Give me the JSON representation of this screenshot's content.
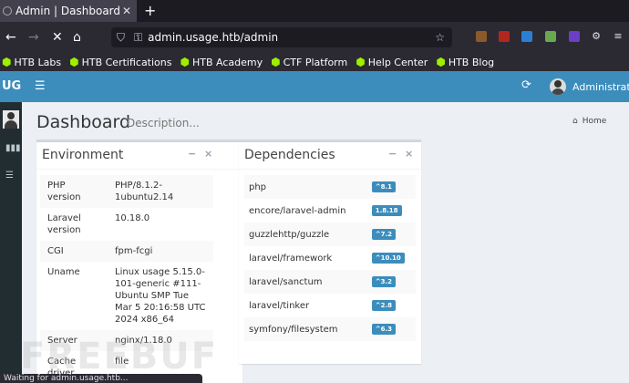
{
  "browser": {
    "tab_title": "Admin | Dashboard",
    "new_tab": "+",
    "url": "admin.usage.htb/admin",
    "bookmarks": [
      "HTB Labs",
      "HTB Certifications",
      "HTB Academy",
      "CTF Platform",
      "Help Center",
      "HTB Blog"
    ],
    "status_text": "Waiting for admin.usage.htb..."
  },
  "header": {
    "logo": "UG",
    "user_name": "Administrator",
    "brand_color": "#3c8dbc"
  },
  "page": {
    "title": "Dashboard",
    "description": "Description...",
    "breadcrumb": "Home"
  },
  "environment": {
    "title": "Environment",
    "rows": [
      {
        "key": "PHP version",
        "value": "PHP/8.1.2-1ubuntu2.14"
      },
      {
        "key": "Laravel version",
        "value": "10.18.0"
      },
      {
        "key": "CGI",
        "value": "fpm-fcgi"
      },
      {
        "key": "Uname",
        "value": "Linux usage 5.15.0-101-generic #111-Ubuntu SMP Tue Mar 5 20:16:58 UTC 2024 x86_64"
      },
      {
        "key": "Server",
        "value": "nginx/1.18.0"
      },
      {
        "key": "Cache driver",
        "value": "file"
      }
    ]
  },
  "dependencies": {
    "title": "Dependencies",
    "rows": [
      {
        "name": "php",
        "version": "^8.1"
      },
      {
        "name": "encore/laravel-admin",
        "version": "1.8.18"
      },
      {
        "name": "guzzlehttp/guzzle",
        "version": "^7.2"
      },
      {
        "name": "laravel/framework",
        "version": "^10.10"
      },
      {
        "name": "laravel/sanctum",
        "version": "^3.2"
      },
      {
        "name": "laravel/tinker",
        "version": "^2.8"
      },
      {
        "name": "symfony/filesystem",
        "version": "^6.3"
      }
    ]
  },
  "box_tools": {
    "collapse": "−",
    "remove": "×"
  },
  "watermark": "FREEBUF"
}
